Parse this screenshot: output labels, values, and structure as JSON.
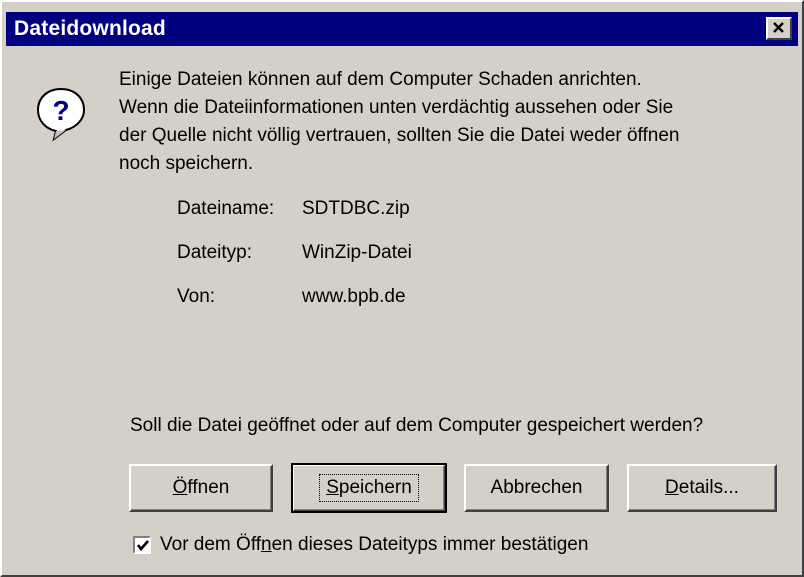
{
  "window": {
    "title": "Dateidownload",
    "close_glyph": "×"
  },
  "message": {
    "lines": [
      "Einige Dateien können auf dem Computer Schaden anrichten.",
      "Wenn die Dateiinformationen unten verdächtig aussehen oder Sie",
      "der Quelle nicht völlig vertrauen, sollten Sie die Datei weder öffnen",
      "noch speichern."
    ],
    "icon": "help-question-icon"
  },
  "file_info": {
    "name_label": "Dateiname:",
    "name_value": "SDTDBC.zip",
    "type_label": "Dateityp:",
    "type_value": "WinZip-Datei",
    "from_label": "Von:",
    "from_value": "www.bpb.de"
  },
  "question": "Soll die Datei geöffnet oder auf dem Computer gespeichert werden?",
  "buttons": {
    "open": {
      "mnemonic": "Ö",
      "rest": "ffnen"
    },
    "save": {
      "mnemonic": "S",
      "rest": "peichern"
    },
    "cancel": {
      "label": "Abbrechen"
    },
    "details": {
      "mnemonic": "D",
      "rest": "etails..."
    }
  },
  "confirm_checkbox": {
    "before": "Vor dem Öff",
    "mnemonic": "n",
    "after": "en dieses Dateityps immer bestätigen",
    "checked": true
  },
  "colors": {
    "titlebar": "#000080",
    "dialog_face": "#d4d0c8"
  }
}
